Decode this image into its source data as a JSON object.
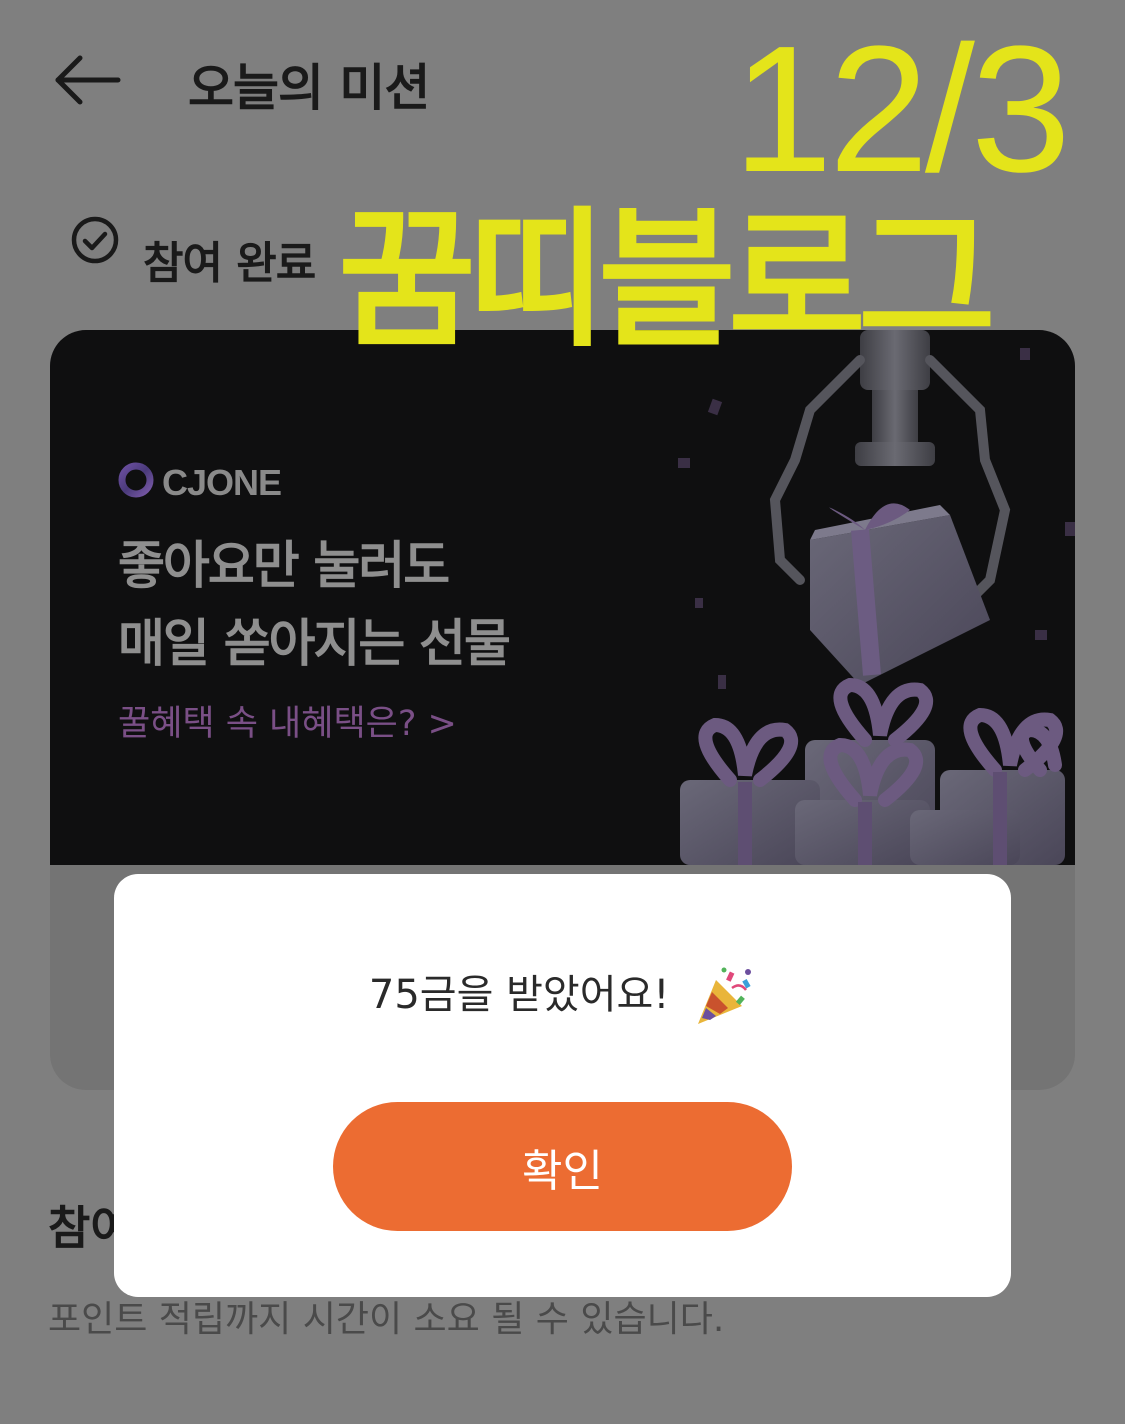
{
  "header": {
    "back_icon": "arrow-left-icon",
    "title": "오늘의 미션"
  },
  "status": {
    "icon": "check-circle-icon",
    "label": "참여 완료"
  },
  "watermark": {
    "date": "12/3",
    "brand": "꿈띠블로그",
    "color": "#e4e41a"
  },
  "banner": {
    "logo_text": "CJONE",
    "title_line1": "좋아요만 눌러도",
    "title_line2": "매일 쏟아지는 선물",
    "link": "꿀혜택 속 내혜택은? >",
    "background": "#0f0f10"
  },
  "section": {
    "title_visible": "참여",
    "notice": "포인트 적립까지 시간이 소요 될 수 있습니다."
  },
  "modal": {
    "message": "75금을 받았어요!",
    "emoji": "party-popper-icon",
    "confirm_label": "확인",
    "accent": "#ec6c32"
  }
}
